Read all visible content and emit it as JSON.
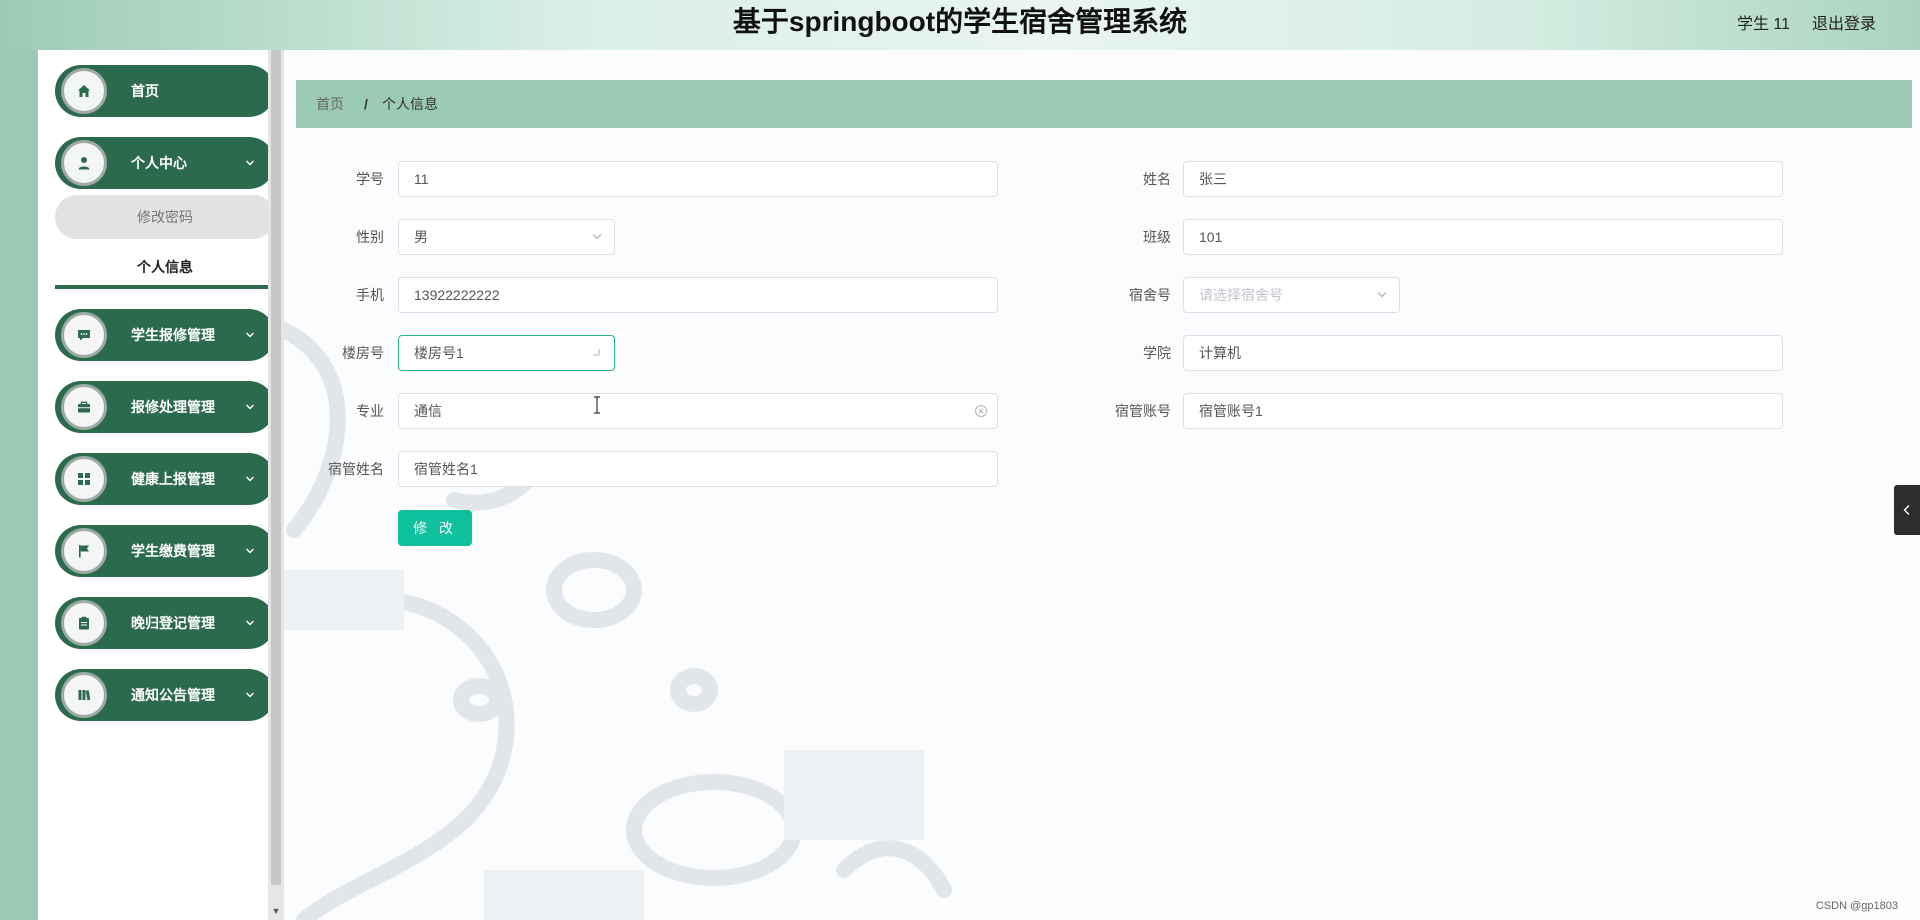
{
  "header": {
    "title": "基于springboot的学生宿舍管理系统",
    "user": "学生 11",
    "logout": "退出登录"
  },
  "sidebar": {
    "items": [
      {
        "label": "首页",
        "icon": "home-icon"
      },
      {
        "label": "个人中心",
        "icon": "user-icon"
      },
      {
        "label": "学生报修管理",
        "icon": "chat-icon"
      },
      {
        "label": "报修处理管理",
        "icon": "briefcase-icon"
      },
      {
        "label": "健康上报管理",
        "icon": "grid-icon"
      },
      {
        "label": "学生缴费管理",
        "icon": "flag-icon"
      },
      {
        "label": "晚归登记管理",
        "icon": "clipboard-icon"
      },
      {
        "label": "通知公告管理",
        "icon": "book-icon"
      }
    ],
    "sub_items": [
      {
        "label": "修改密码"
      },
      {
        "label": "个人信息"
      }
    ]
  },
  "breadcrumb": {
    "home": "首页",
    "separator": "/",
    "current": "个人信息"
  },
  "form": {
    "student_id": {
      "label": "学号",
      "value": "11"
    },
    "name": {
      "label": "姓名",
      "value": "张三"
    },
    "gender": {
      "label": "性别",
      "value": "男"
    },
    "class": {
      "label": "班级",
      "value": "101"
    },
    "phone": {
      "label": "手机",
      "value": "13922222222"
    },
    "dorm_no": {
      "label": "宿舍号",
      "placeholder": "请选择宿舍号"
    },
    "building": {
      "label": "楼房号",
      "value": "楼房号1"
    },
    "college": {
      "label": "学院",
      "value": "计算机"
    },
    "major": {
      "label": "专业",
      "value": "通信"
    },
    "manager_account": {
      "label": "宿管账号",
      "value": "宿管账号1"
    },
    "manager_name": {
      "label": "宿管姓名",
      "value": "宿管姓名1"
    },
    "submit_label": "修 改"
  },
  "footer": {
    "watermark": "CSDN @gp1803"
  },
  "colors": {
    "primary": "#2c6a4e",
    "accent": "#9ccbb5",
    "button": "#0fc19c"
  }
}
